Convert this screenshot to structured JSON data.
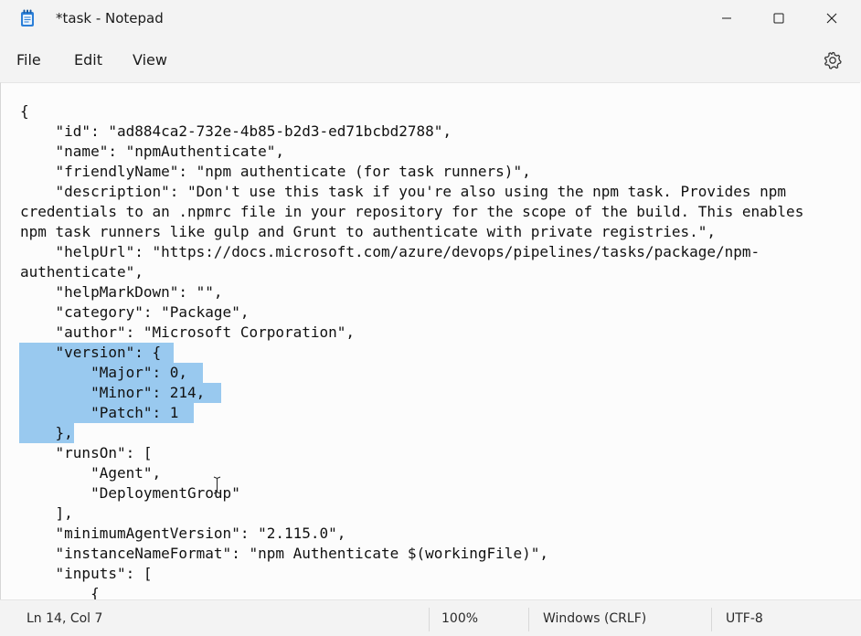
{
  "window": {
    "title": "*task - Notepad",
    "minimize_icon": "minimize-icon",
    "maximize_icon": "maximize-icon",
    "close_icon": "close-icon"
  },
  "menu": {
    "file": "File",
    "edit": "Edit",
    "view": "View",
    "settings_icon": "gear-icon"
  },
  "editor": {
    "lines": [
      "{",
      "    \"id\": \"ad884ca2-732e-4b85-b2d3-ed71bcbd2788\",",
      "    \"name\": \"npmAuthenticate\",",
      "    \"friendlyName\": \"npm authenticate (for task runners)\",",
      "    \"description\": \"Don't use this task if you're also using the npm task. Provides npm",
      "credentials to an .npmrc file in your repository for the scope of the build. This enables",
      "npm task runners like gulp and Grunt to authenticate with private registries.\",",
      "    \"helpUrl\": \"https://docs.microsoft.com/azure/devops/pipelines/tasks/package/npm-",
      "authenticate\",",
      "    \"helpMarkDown\": \"\",",
      "    \"category\": \"Package\",",
      "    \"author\": \"Microsoft Corporation\",",
      "    \"version\": {",
      "        \"Major\": 0,",
      "        \"Minor\": 214,",
      "        \"Patch\": 1",
      "    },",
      "    \"runsOn\": [",
      "        \"Agent\",",
      "        \"DeploymentGroup\"",
      "    ],",
      "    \"minimumAgentVersion\": \"2.115.0\",",
      "    \"instanceNameFormat\": \"npm Authenticate $(workingFile)\",",
      "    \"inputs\": [",
      "        {"
    ],
    "selection_color": "#99c9ef"
  },
  "status": {
    "position": "Ln 14, Col 7",
    "zoom": "100%",
    "line_ending": "Windows (CRLF)",
    "encoding": "UTF-8"
  }
}
